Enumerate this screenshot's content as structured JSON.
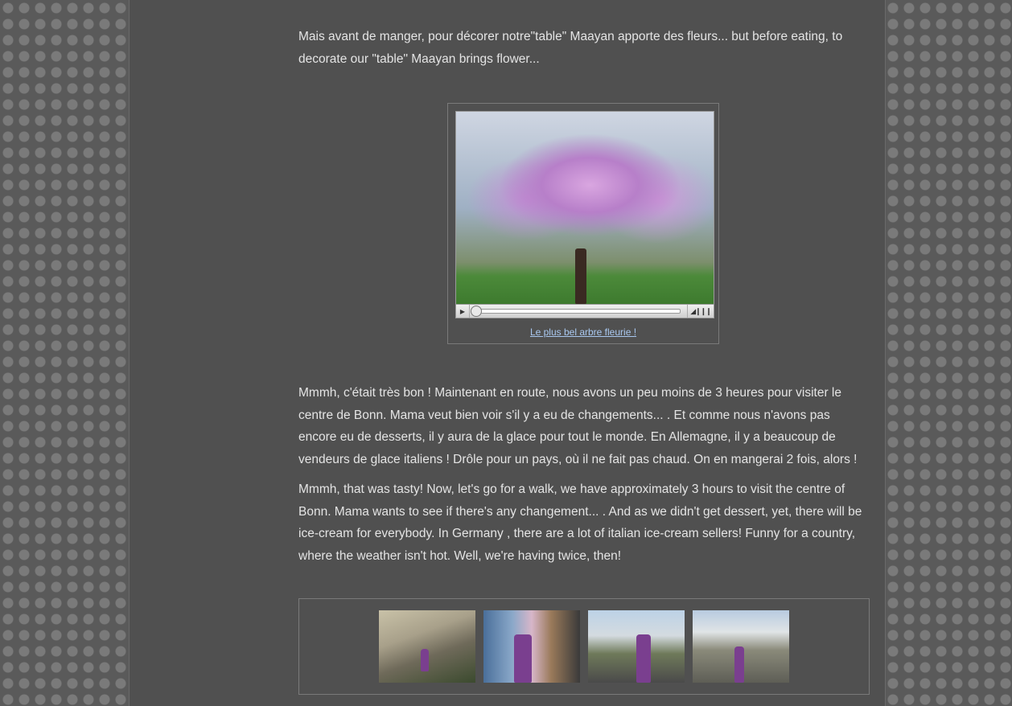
{
  "paragraphs": {
    "intro": "Mais avant de manger, pour décorer notre\"table\" Maayan apporte des fleurs... but before eating, to decorate our \"table\" Maayan brings flower...",
    "french": "Mmmh, c'était très bon ! Maintenant en route, nous avons un peu moins de 3 heures pour visiter le centre de Bonn. Mama veut bien voir s'il y a eu de changements... . Et comme nous n'avons pas encore eu de desserts, il y aura de la glace pour tout le monde. En Allemagne, il y a beaucoup de vendeurs de glace italiens ! Drôle pour un pays, où il ne fait pas chaud. On en mangerai 2 fois, alors !",
    "english": " Mmmh, that was tasty! Now, let's go for a walk, we have approximately 3 hours to visit the centre of Bonn. Mama wants to see if there's any changement... . And as we didn't get dessert, yet, there will be ice-cream for everybody. In Germany , there are a lot of italian ice-cream sellers! Funny for a country, where the weather isn't hot. Well, we're having twice, then!"
  },
  "video": {
    "caption": "Le plus bel arbre fleurie !",
    "play_icon": "play-icon",
    "volume_icon": "volume-icon",
    "progress": 0
  },
  "gallery": {
    "thumb_count": 4
  }
}
